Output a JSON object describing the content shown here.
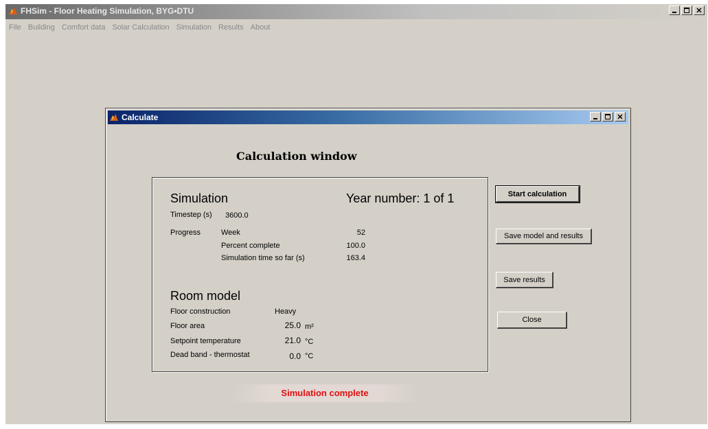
{
  "main_window": {
    "title": "FHSim - Floor Heating Simulation, BYG•DTU",
    "menu": [
      "File",
      "Building",
      "Comfort data",
      "Solar Calculation",
      "Simulation",
      "Results",
      "About"
    ]
  },
  "dialog": {
    "title": "Calculate",
    "heading": "Calculation window",
    "simulation": {
      "title": "Simulation",
      "year_label": "Year number: 1 of 1",
      "timestep_label": "Timestep (s)",
      "timestep_value": "3600.0",
      "progress_label": "Progress",
      "week_label": "Week",
      "week_value": "52",
      "percent_label": "Percent complete",
      "percent_value": "100.0",
      "simtime_label": "Simulation time so far (s)",
      "simtime_value": "163.4"
    },
    "room_model": {
      "title": "Room model",
      "floor_construction_label": "Floor construction",
      "floor_construction_value": "Heavy",
      "floor_area_label": "Floor area",
      "floor_area_value": "25.0",
      "floor_area_unit": "m²",
      "setpoint_label": "Setpoint temperature",
      "setpoint_value": "21.0",
      "setpoint_unit": "°C",
      "deadband_label": "Dead band - thermostat",
      "deadband_value": "0.0",
      "deadband_unit": "°C"
    },
    "buttons": {
      "start": "Start calculation",
      "save_model": "Save model and results",
      "save_results": "Save results",
      "close": "Close"
    },
    "status": "Simulation complete"
  }
}
